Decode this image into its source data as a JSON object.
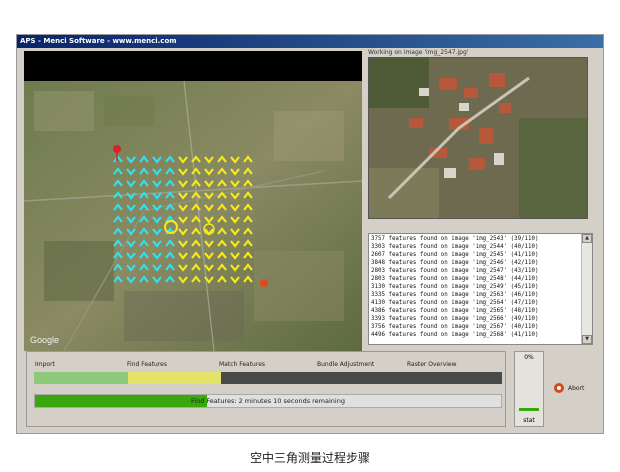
{
  "window": {
    "title": "APS - Menci Software - www.menci.com"
  },
  "map": {
    "watermark": "Google",
    "chevron_colors": {
      "placed": "#33e0f0",
      "pending": "#f5ea1a"
    }
  },
  "preview": {
    "label": "Working on image 'img_2547.jpg'"
  },
  "log": {
    "lines": [
      "3757 features found on image 'img_2543' (39/110)",
      "3303 features found on image 'img_2544' (40/110)",
      "2607 features found on image 'img_2545' (41/110)",
      "3848 features found on image 'img_2546' (42/110)",
      "2803 features found on image 'img_2547' (43/110)",
      "2803 features found on image 'img_2548' (44/110)",
      "3130 features found on image 'img_2549' (45/110)",
      "3335 features found on image 'img_2563' (46/110)",
      "4130 features found on image 'img_2564' (47/110)",
      "4386 features found on image 'img_2565' (48/110)",
      "3393 features found on image 'img_2566' (49/110)",
      "3756 features found on image 'img_2567' (40/110)",
      "4496 features found on image 'img_2568' (41/110)"
    ]
  },
  "stages": {
    "labels": [
      "Import",
      "Find Features",
      "Match Features",
      "Bundle Adjustment",
      "Raster Overview"
    ],
    "import_fraction": 0.2,
    "find_fraction": 0.2,
    "colors": {
      "import": "#8cc97a",
      "find": "#e3e36a"
    }
  },
  "overall": {
    "text": "Find Features: 2 minutes 10 seconds remaining",
    "fraction": 0.37
  },
  "side": {
    "percent": "0%",
    "stat_label": "stat"
  },
  "abort": {
    "label": "Abort"
  },
  "caption": "空中三角测量过程步骤"
}
